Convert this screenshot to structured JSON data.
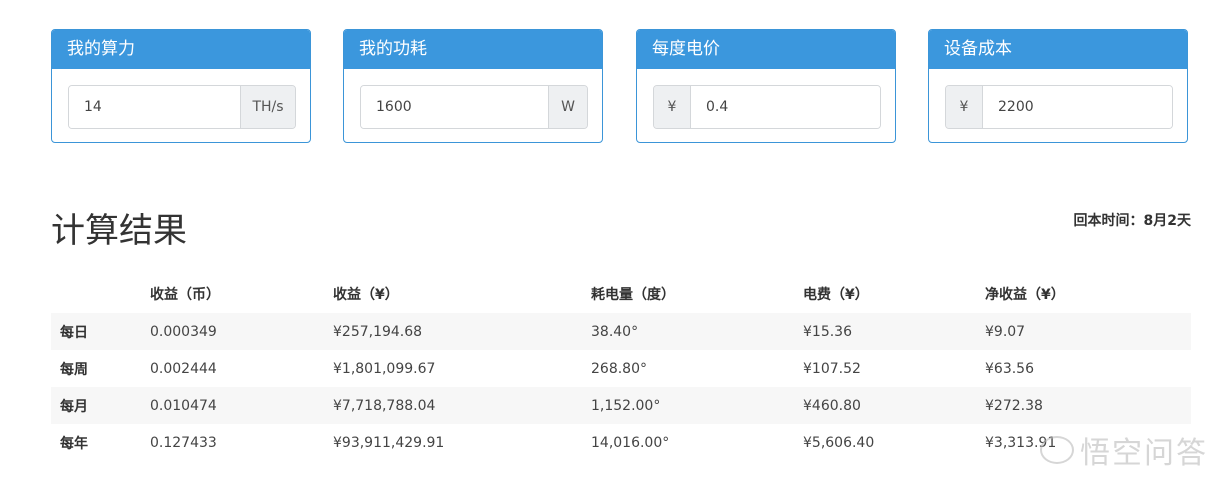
{
  "panels": [
    {
      "title": "我的算力",
      "value": "14",
      "addon": "TH/s",
      "addon_side": "right"
    },
    {
      "title": "我的功耗",
      "value": "1600",
      "addon": "W",
      "addon_side": "right"
    },
    {
      "title": "每度电价",
      "value": "0.4",
      "addon": "¥",
      "addon_side": "left"
    },
    {
      "title": "设备成本",
      "value": "2200",
      "addon": "¥",
      "addon_side": "left"
    }
  ],
  "results": {
    "title": "计算结果",
    "payback": "回本时间：8月2天",
    "headers": [
      "",
      "收益（币）",
      "收益（¥）",
      "耗电量（度）",
      "电费（¥）",
      "净收益（¥）"
    ],
    "rows": [
      [
        "每日",
        "0.000349",
        "¥257,194.68",
        "38.40°",
        "¥15.36",
        "¥9.07"
      ],
      [
        "每周",
        "0.002444",
        "¥1,801,099.67",
        "268.80°",
        "¥107.52",
        "¥63.56"
      ],
      [
        "每月",
        "0.010474",
        "¥7,718,788.04",
        "1,152.00°",
        "¥460.80",
        "¥272.38"
      ],
      [
        "每年",
        "0.127433",
        "¥93,911,429.91",
        "14,016.00°",
        "¥5,606.40",
        "¥3,313.91"
      ]
    ]
  },
  "watermark": "悟空问答",
  "colors": {
    "panel_header": "#3b97dd",
    "panel_border": "#3b95d8",
    "row_stripe": "#f7f7f7"
  }
}
